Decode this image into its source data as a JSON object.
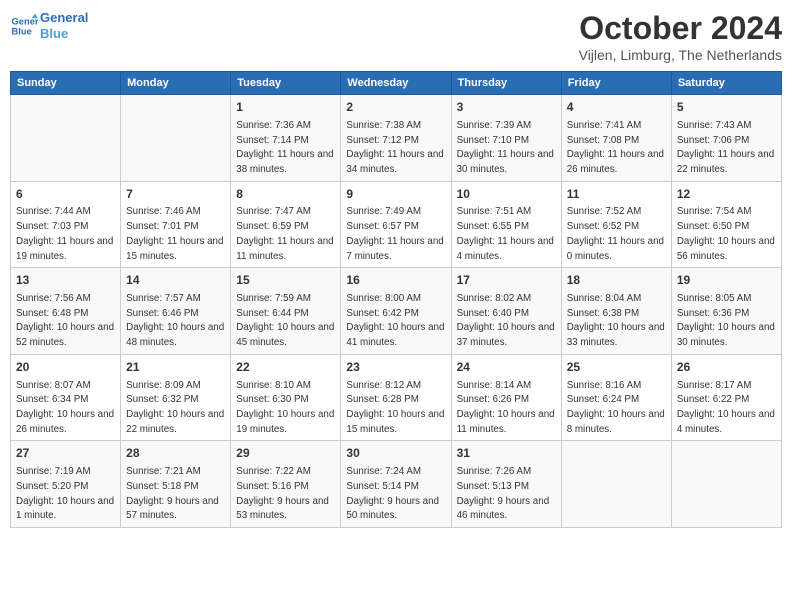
{
  "header": {
    "logo": {
      "line1": "General",
      "line2": "Blue"
    },
    "title": "October 2024",
    "subtitle": "Vijlen, Limburg, The Netherlands"
  },
  "weekdays": [
    "Sunday",
    "Monday",
    "Tuesday",
    "Wednesday",
    "Thursday",
    "Friday",
    "Saturday"
  ],
  "weeks": [
    [
      {
        "day": "",
        "info": ""
      },
      {
        "day": "",
        "info": ""
      },
      {
        "day": "1",
        "info": "Sunrise: 7:36 AM\nSunset: 7:14 PM\nDaylight: 11 hours and 38 minutes."
      },
      {
        "day": "2",
        "info": "Sunrise: 7:38 AM\nSunset: 7:12 PM\nDaylight: 11 hours and 34 minutes."
      },
      {
        "day": "3",
        "info": "Sunrise: 7:39 AM\nSunset: 7:10 PM\nDaylight: 11 hours and 30 minutes."
      },
      {
        "day": "4",
        "info": "Sunrise: 7:41 AM\nSunset: 7:08 PM\nDaylight: 11 hours and 26 minutes."
      },
      {
        "day": "5",
        "info": "Sunrise: 7:43 AM\nSunset: 7:06 PM\nDaylight: 11 hours and 22 minutes."
      }
    ],
    [
      {
        "day": "6",
        "info": "Sunrise: 7:44 AM\nSunset: 7:03 PM\nDaylight: 11 hours and 19 minutes."
      },
      {
        "day": "7",
        "info": "Sunrise: 7:46 AM\nSunset: 7:01 PM\nDaylight: 11 hours and 15 minutes."
      },
      {
        "day": "8",
        "info": "Sunrise: 7:47 AM\nSunset: 6:59 PM\nDaylight: 11 hours and 11 minutes."
      },
      {
        "day": "9",
        "info": "Sunrise: 7:49 AM\nSunset: 6:57 PM\nDaylight: 11 hours and 7 minutes."
      },
      {
        "day": "10",
        "info": "Sunrise: 7:51 AM\nSunset: 6:55 PM\nDaylight: 11 hours and 4 minutes."
      },
      {
        "day": "11",
        "info": "Sunrise: 7:52 AM\nSunset: 6:52 PM\nDaylight: 11 hours and 0 minutes."
      },
      {
        "day": "12",
        "info": "Sunrise: 7:54 AM\nSunset: 6:50 PM\nDaylight: 10 hours and 56 minutes."
      }
    ],
    [
      {
        "day": "13",
        "info": "Sunrise: 7:56 AM\nSunset: 6:48 PM\nDaylight: 10 hours and 52 minutes."
      },
      {
        "day": "14",
        "info": "Sunrise: 7:57 AM\nSunset: 6:46 PM\nDaylight: 10 hours and 48 minutes."
      },
      {
        "day": "15",
        "info": "Sunrise: 7:59 AM\nSunset: 6:44 PM\nDaylight: 10 hours and 45 minutes."
      },
      {
        "day": "16",
        "info": "Sunrise: 8:00 AM\nSunset: 6:42 PM\nDaylight: 10 hours and 41 minutes."
      },
      {
        "day": "17",
        "info": "Sunrise: 8:02 AM\nSunset: 6:40 PM\nDaylight: 10 hours and 37 minutes."
      },
      {
        "day": "18",
        "info": "Sunrise: 8:04 AM\nSunset: 6:38 PM\nDaylight: 10 hours and 33 minutes."
      },
      {
        "day": "19",
        "info": "Sunrise: 8:05 AM\nSunset: 6:36 PM\nDaylight: 10 hours and 30 minutes."
      }
    ],
    [
      {
        "day": "20",
        "info": "Sunrise: 8:07 AM\nSunset: 6:34 PM\nDaylight: 10 hours and 26 minutes."
      },
      {
        "day": "21",
        "info": "Sunrise: 8:09 AM\nSunset: 6:32 PM\nDaylight: 10 hours and 22 minutes."
      },
      {
        "day": "22",
        "info": "Sunrise: 8:10 AM\nSunset: 6:30 PM\nDaylight: 10 hours and 19 minutes."
      },
      {
        "day": "23",
        "info": "Sunrise: 8:12 AM\nSunset: 6:28 PM\nDaylight: 10 hours and 15 minutes."
      },
      {
        "day": "24",
        "info": "Sunrise: 8:14 AM\nSunset: 6:26 PM\nDaylight: 10 hours and 11 minutes."
      },
      {
        "day": "25",
        "info": "Sunrise: 8:16 AM\nSunset: 6:24 PM\nDaylight: 10 hours and 8 minutes."
      },
      {
        "day": "26",
        "info": "Sunrise: 8:17 AM\nSunset: 6:22 PM\nDaylight: 10 hours and 4 minutes."
      }
    ],
    [
      {
        "day": "27",
        "info": "Sunrise: 7:19 AM\nSunset: 5:20 PM\nDaylight: 10 hours and 1 minute."
      },
      {
        "day": "28",
        "info": "Sunrise: 7:21 AM\nSunset: 5:18 PM\nDaylight: 9 hours and 57 minutes."
      },
      {
        "day": "29",
        "info": "Sunrise: 7:22 AM\nSunset: 5:16 PM\nDaylight: 9 hours and 53 minutes."
      },
      {
        "day": "30",
        "info": "Sunrise: 7:24 AM\nSunset: 5:14 PM\nDaylight: 9 hours and 50 minutes."
      },
      {
        "day": "31",
        "info": "Sunrise: 7:26 AM\nSunset: 5:13 PM\nDaylight: 9 hours and 46 minutes."
      },
      {
        "day": "",
        "info": ""
      },
      {
        "day": "",
        "info": ""
      }
    ]
  ]
}
